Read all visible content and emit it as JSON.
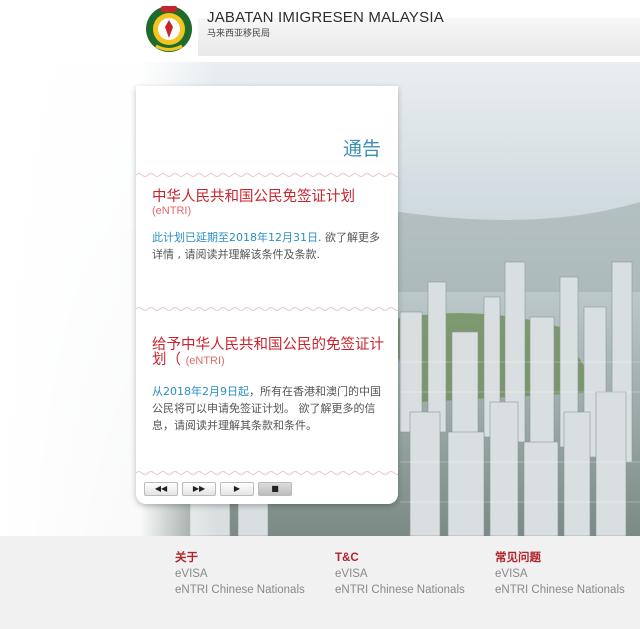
{
  "header": {
    "title": "JABATAN IMIGRESEN MALAYSIA",
    "subtitle": "马来西亚移民局",
    "logo_icon": "immigration-crest-icon",
    "logo_text": "IMIGRESEN MALAYSIA"
  },
  "notice": {
    "title": "通告",
    "items": [
      {
        "title": "中华人民共和国公民免签证计划",
        "tag": "(eNTRI)",
        "highlight": "此计划已延期至2018年12月31日",
        "body": ". 欲了解更多详情 , 请阅读并理解该条件及条款."
      },
      {
        "title": "给予中华人民共和国公民的免签证计划（",
        "tag": "(eNTRI)",
        "highlight": "从2018年2月9日起",
        "body": "，所有在香港和澳门的中国公民将可以申请免签证计划。 欲了解更多的信息，请阅读并理解其条款和条件。"
      }
    ],
    "controls": {
      "prev": "◀◀",
      "next": "▶▶",
      "play": "▶",
      "stop": "■"
    }
  },
  "footer": {
    "columns": [
      {
        "heading": "关于",
        "links": [
          "eVISA",
          "eNTRI Chinese Nationals"
        ]
      },
      {
        "heading": "T&C",
        "links": [
          "eVISA",
          "eNTRI Chinese Nationals"
        ]
      },
      {
        "heading": "常见问题",
        "links": [
          "eVISA",
          "eNTRI Chinese Nationals"
        ]
      }
    ]
  },
  "colors": {
    "accent_red": "#c8242d",
    "accent_blue": "#3d8fb4",
    "link_blue": "#2b8fc2"
  }
}
